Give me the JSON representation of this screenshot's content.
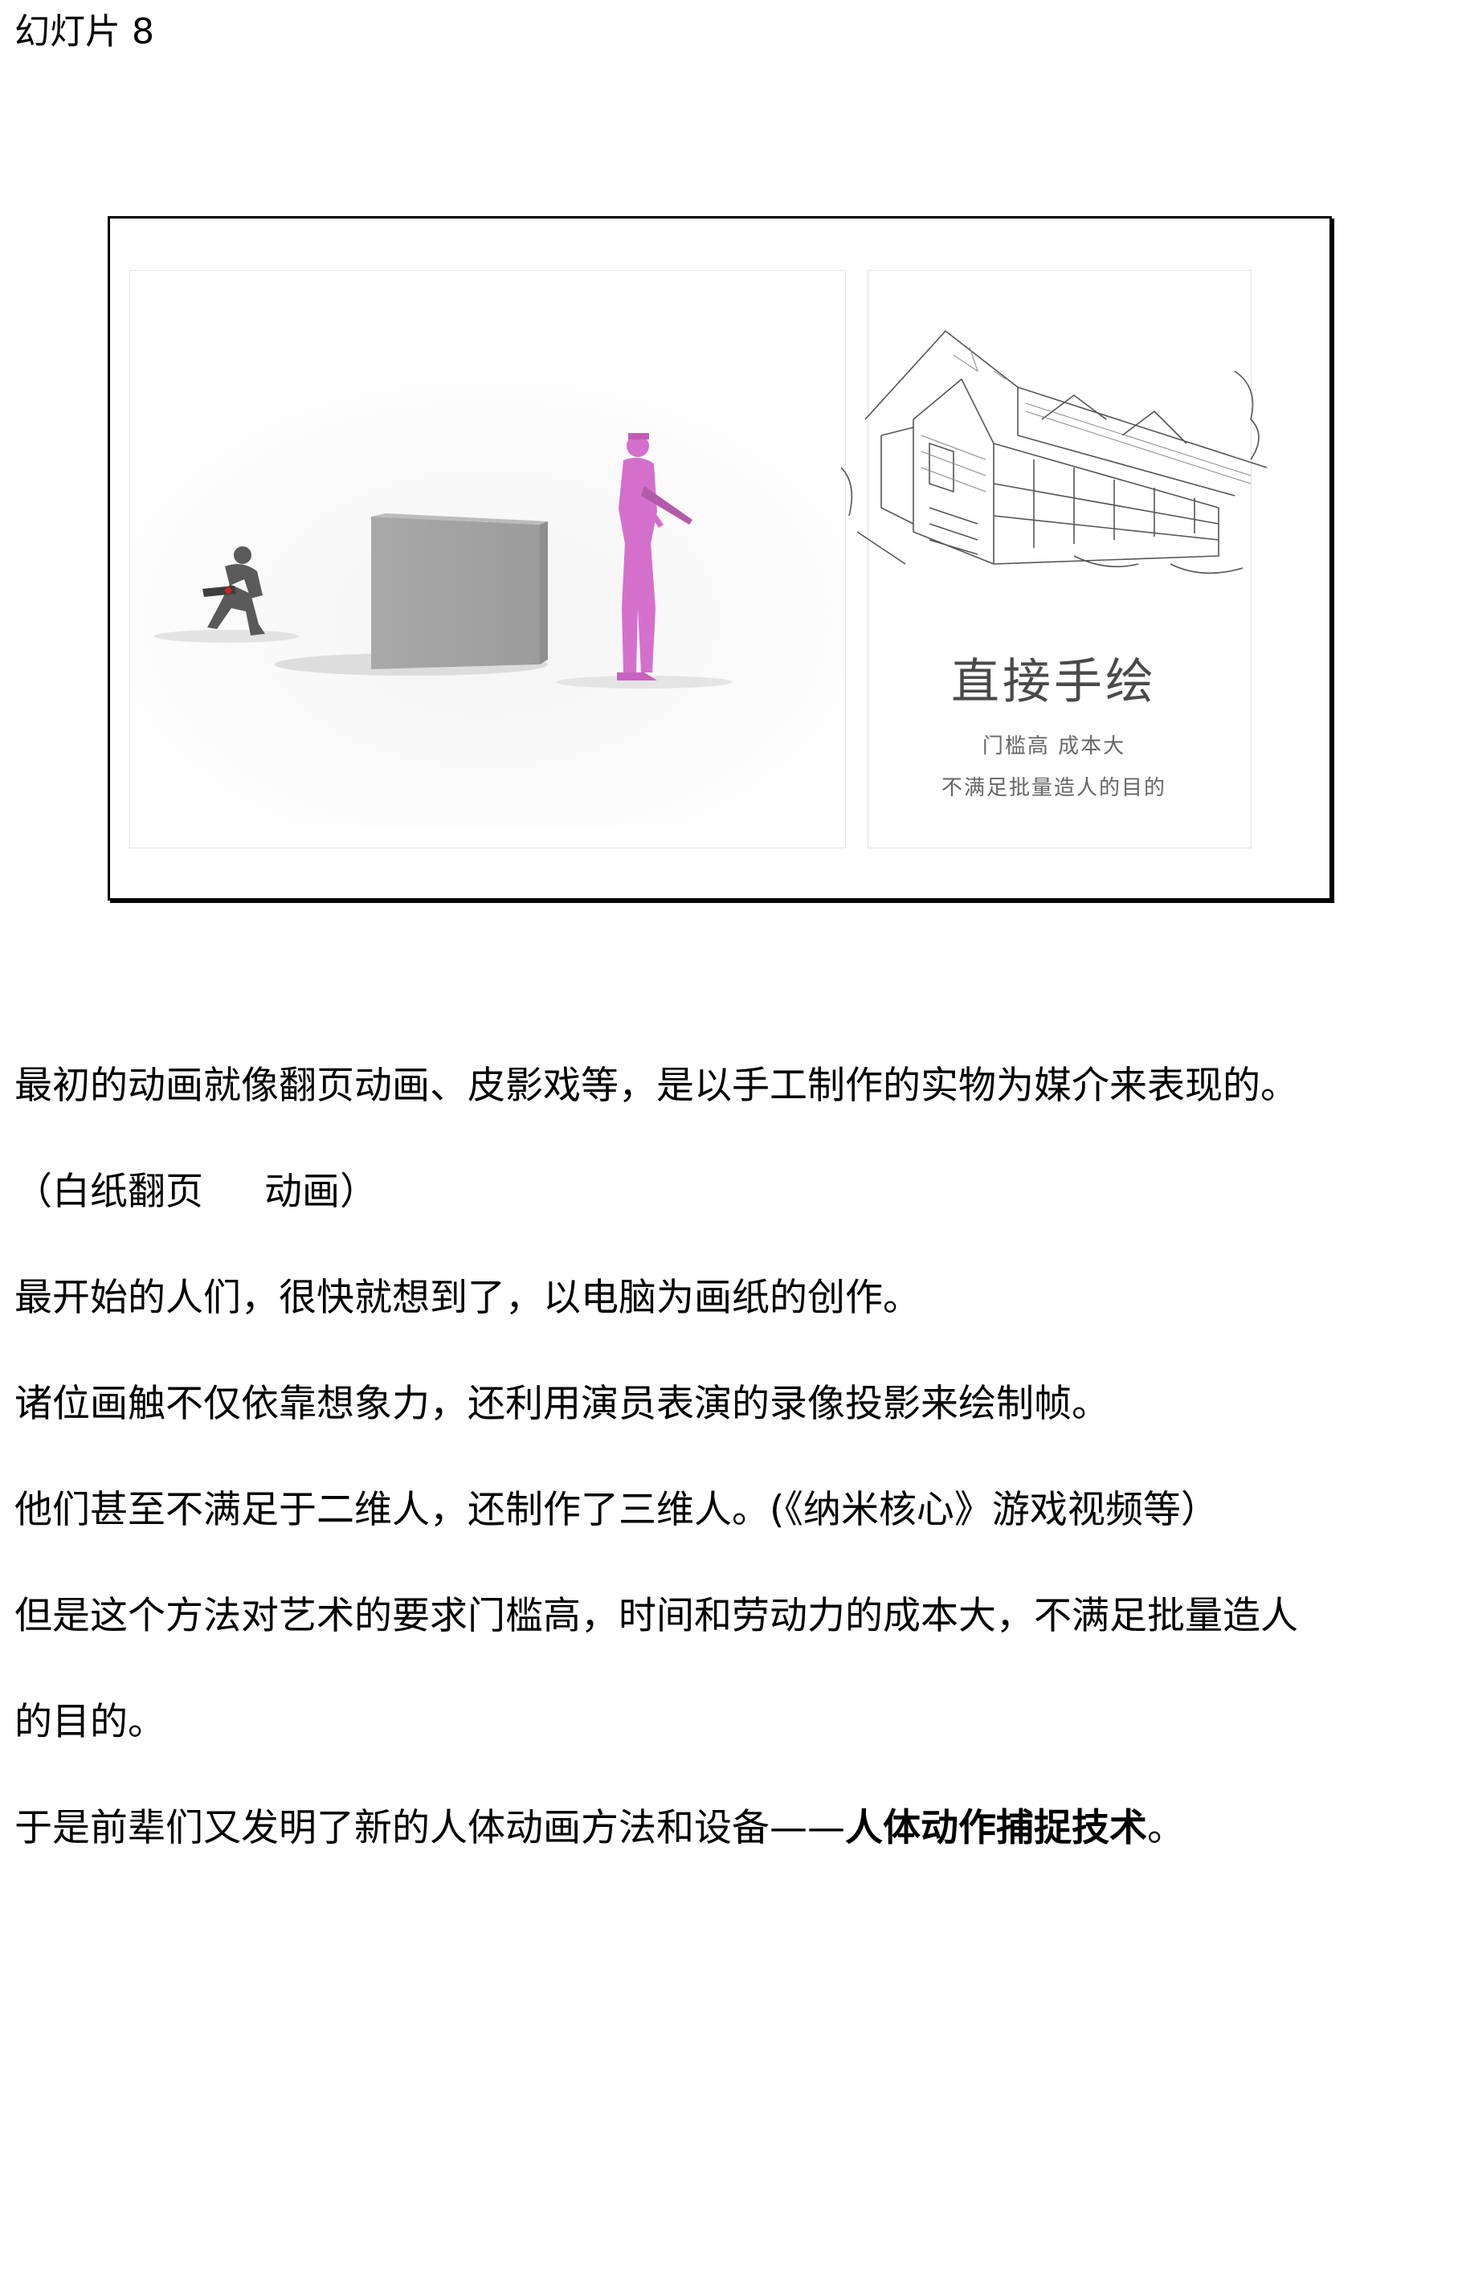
{
  "heading": "幻灯片 8",
  "slide": {
    "title": "直接手绘",
    "subtitle_line1": "门槛高 成本大",
    "subtitle_line2": "不满足批量造人的目的"
  },
  "paragraphs": {
    "p1": "最初的动画就像翻页动画、皮影戏等，是以手工制作的实物为媒介来表现的。",
    "p2a": "（白纸翻页",
    "p2b": "动画）",
    "p3": "最开始的人们，很快就想到了，以电脑为画纸的创作。",
    "p4": "诸位画触不仅依靠想象力，还利用演员表演的录像投影来绘制帧。",
    "p5": "他们甚至不满足于二维人，还制作了三维人。(《纳米核心》游戏视频等）",
    "p6a": "但是这个方法对艺术的要求门槛高，时间和劳动力的成本大，不满足批量造人",
    "p6b": "的目的。",
    "p7_normal": "于是前辈们又发明了新的人体动画方法和设备——",
    "p7_bold": "人体动作捕捉技术",
    "p7_end": "。"
  }
}
